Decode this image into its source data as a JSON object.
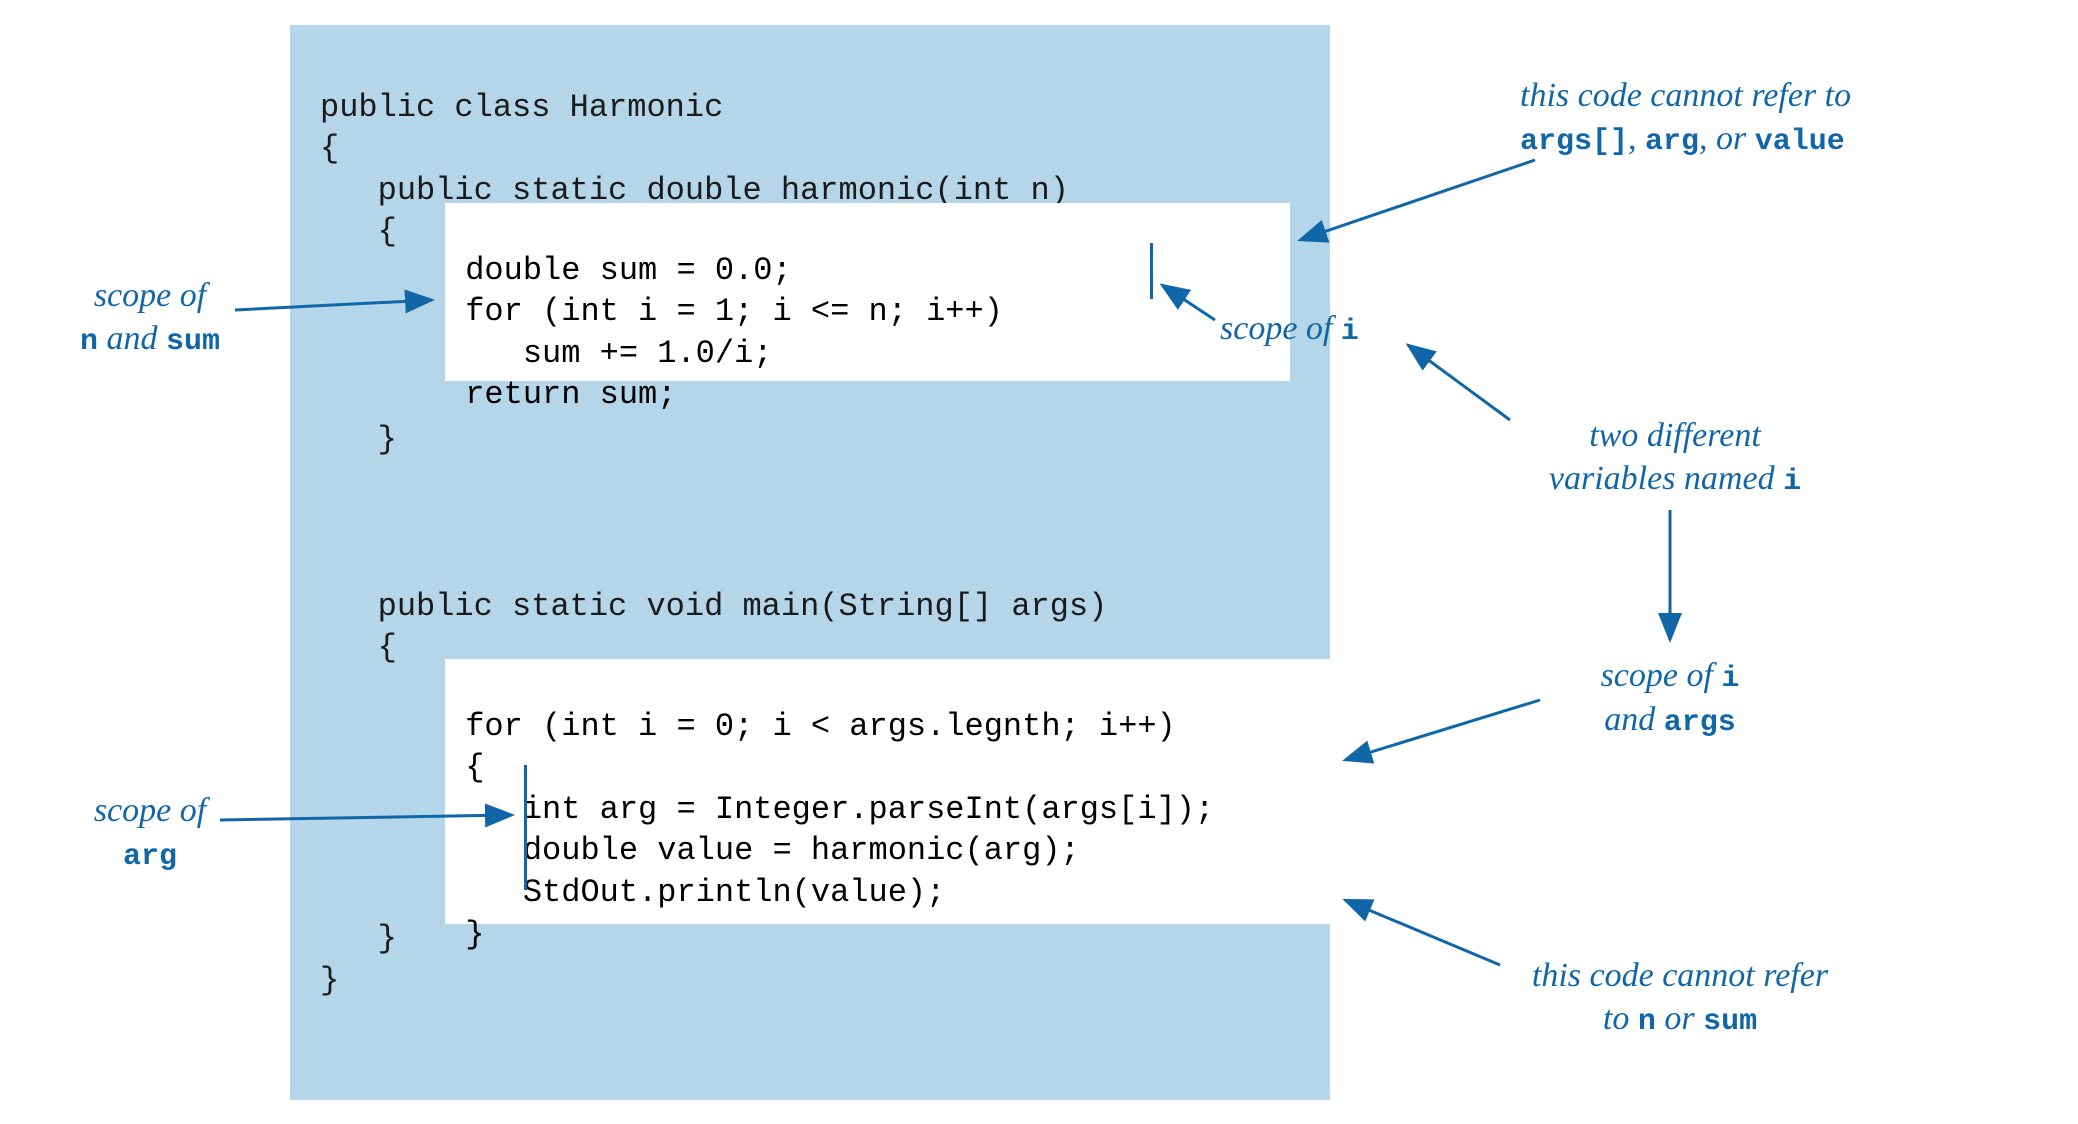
{
  "code": {
    "line1": "public class Harmonic",
    "line2": "{",
    "line3": "   public static double harmonic(int n)",
    "line4": "   {",
    "line5": "      double sum = 0.0;",
    "line6": "      for (int i = 1; i <= n; i++)",
    "line7": "         sum += 1.0/i;",
    "line8": "      return sum;",
    "line9": "   }",
    "line10": "   public static void main(String[] args)",
    "line11": "   {",
    "line12": "      for (int i = 0; i < args.legnth; i++)",
    "line13": "      {",
    "line14": "         int arg = Integer.parseInt(args[i]);",
    "line15": "         double value = harmonic(arg);",
    "line16": "         StdOut.println(value);",
    "line17": "      }",
    "line18": "   }",
    "line19": "}"
  },
  "annotations": {
    "scope_n_sum_1": "scope of",
    "scope_n_sum_2_a": "n",
    "scope_n_sum_2_b": " and ",
    "scope_n_sum_2_c": "sum",
    "scope_arg_1": "scope of",
    "scope_arg_2": "arg",
    "cannot_refer_args_1": "this code cannot refer to",
    "cannot_refer_args_2_a": "args[]",
    "cannot_refer_args_2_b": ", ",
    "cannot_refer_args_2_c": "arg",
    "cannot_refer_args_2_d": ", or ",
    "cannot_refer_args_2_e": "value",
    "scope_i_1": "scope of ",
    "scope_i_1_var": "i",
    "two_diff_1": "two different",
    "two_diff_2_a": "variables named ",
    "two_diff_2_b": "i",
    "scope_i_args_1_a": "scope of ",
    "scope_i_args_1_b": "i",
    "scope_i_args_2_a": "and ",
    "scope_i_args_2_b": "args",
    "cannot_refer_n_1": "this code cannot refer",
    "cannot_refer_n_2_a": "to ",
    "cannot_refer_n_2_b": "n",
    "cannot_refer_n_2_c": " or ",
    "cannot_refer_n_2_d": "sum"
  }
}
